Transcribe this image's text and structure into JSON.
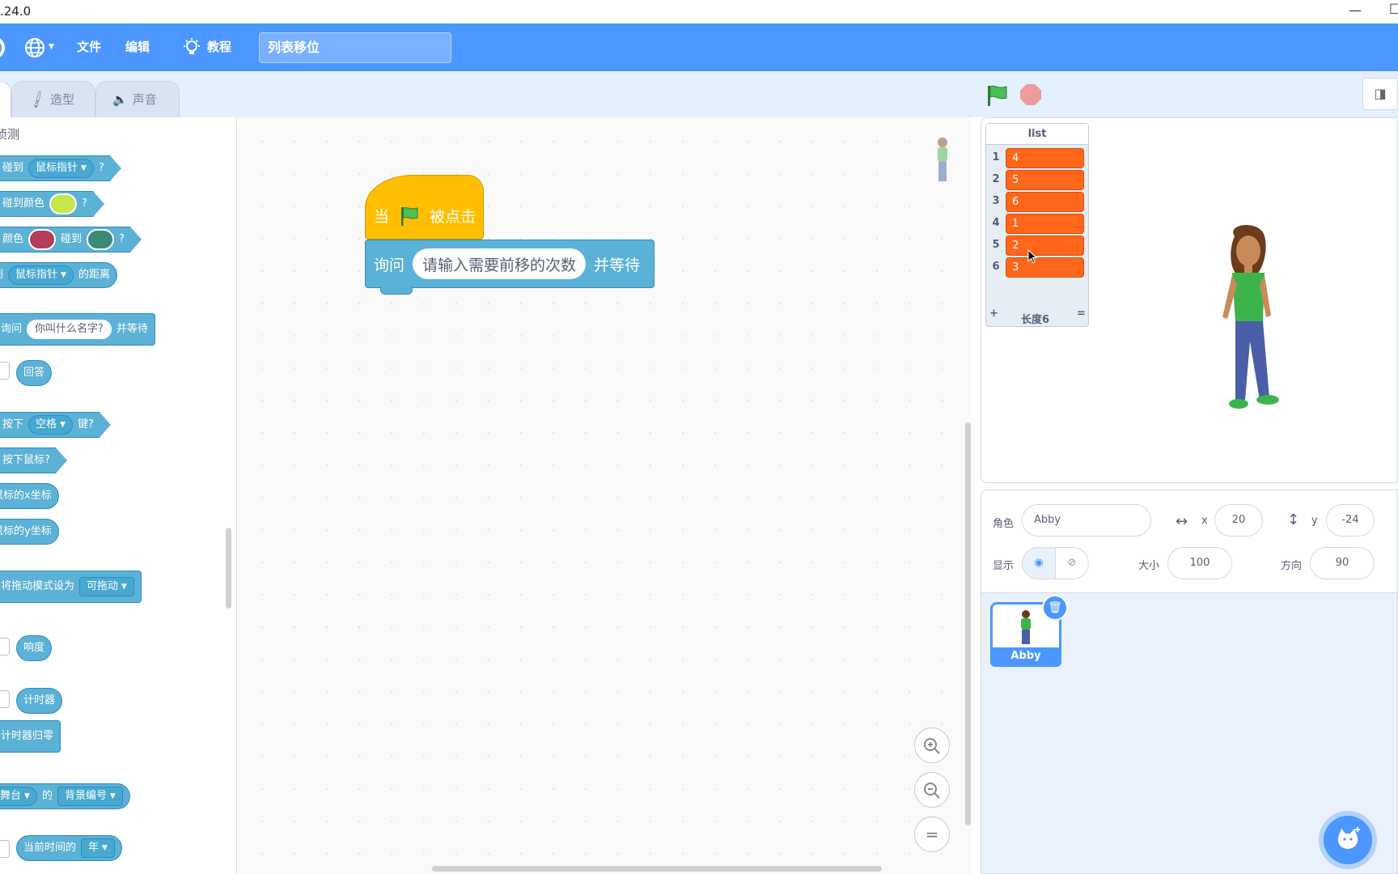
{
  "window": {
    "title": ".24.0",
    "minimize": "—"
  },
  "menubar": {
    "file": "文件",
    "edit": "编辑",
    "tutorials": "教程",
    "project_title": "列表移位"
  },
  "tabs": {
    "costumes": "造型",
    "sounds": "声音"
  },
  "palette": {
    "category": "侦测",
    "touching": "碰到",
    "mouse_pointer": "鼠标指针",
    "q": "?",
    "touching_color": "碰到颜色",
    "color": "颜色",
    "touching2": "碰到",
    "distance_to": "到",
    "distance_suffix": "的距离",
    "ask": "询问",
    "ask_default": "你叫什么名字?",
    "and_wait": "并等待",
    "answer": "回答",
    "key_press": "按下",
    "space": "空格",
    "key_suffix": "键?",
    "mouse_down": "按下鼠标?",
    "mouse_x": "鼠标的x坐标",
    "mouse_y": "鼠标的y坐标",
    "set_drag": "将拖动模式设为",
    "draggable": "可拖动",
    "loudness": "响度",
    "timer": "计时器",
    "reset_timer": "计时器归零",
    "stage": "舞台",
    "of": "的",
    "backdrop_no": "背景编号",
    "current": "当前时间的",
    "year": "年",
    "colors": {
      "touch_color": "#c5e84a",
      "color_a": "#b33d5b",
      "color_b": "#3a8a7a"
    }
  },
  "script": {
    "when": "当",
    "clicked": "被点击",
    "ask": "询问",
    "prompt": "请输入需要前移的次数",
    "and_wait": "并等待"
  },
  "stage": {
    "list": {
      "name": "list",
      "items": [
        {
          "index": "1",
          "value": "4"
        },
        {
          "index": "2",
          "value": "5"
        },
        {
          "index": "3",
          "value": "6"
        },
        {
          "index": "4",
          "value": "1"
        },
        {
          "index": "5",
          "value": "2"
        },
        {
          "index": "6",
          "value": "3"
        }
      ],
      "add": "+",
      "length": "长度6",
      "resize": "="
    }
  },
  "sprite": {
    "label_sprite": "角色",
    "name": "Abby",
    "x_label": "x",
    "x": "20",
    "y_label": "y",
    "y": "-24",
    "show_label": "显示",
    "size_label": "大小",
    "size": "100",
    "direction_label": "方向",
    "direction": "90",
    "thumb_name": "Abby"
  },
  "colors": {
    "accent": "#4c97ff",
    "list_item": "#ff661a",
    "sensing": "#5cb1d6",
    "events": "#ffbf00"
  }
}
